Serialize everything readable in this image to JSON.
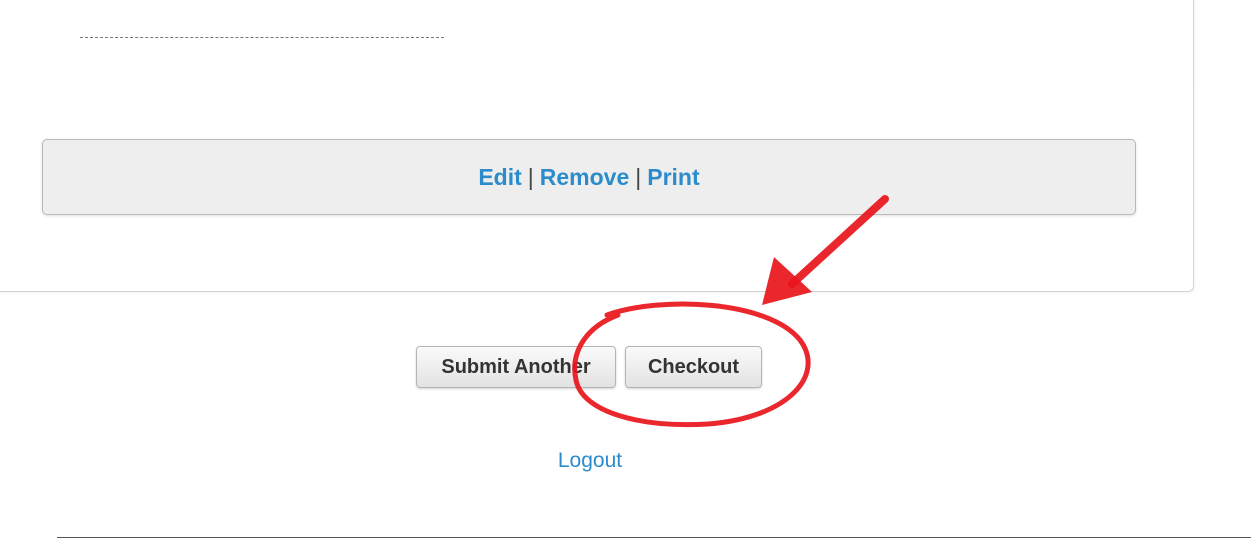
{
  "actions": {
    "edit": "Edit",
    "separator": "|",
    "remove": "Remove",
    "print": "Print"
  },
  "buttons": {
    "submit_another": "Submit Another",
    "checkout": "Checkout"
  },
  "logout": "Logout",
  "annotation": {
    "color": "#e8151b"
  }
}
